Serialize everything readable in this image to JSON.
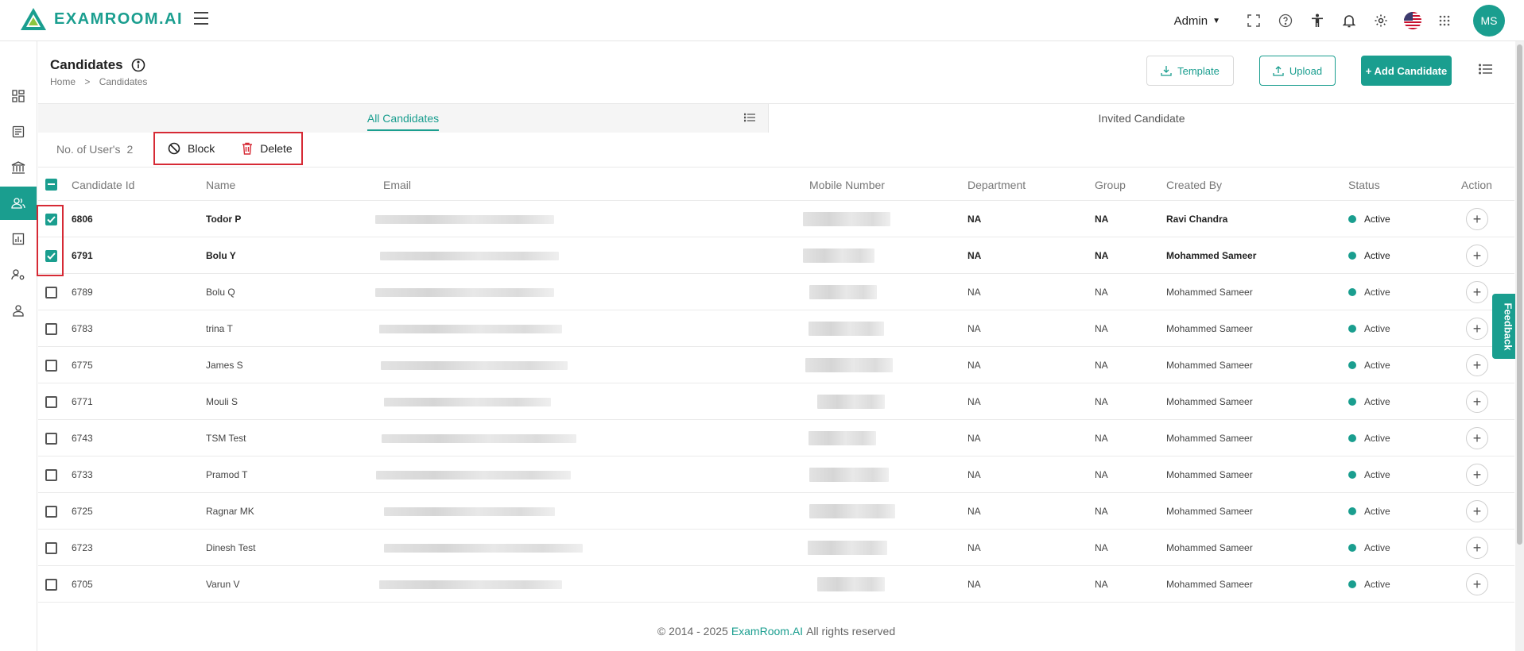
{
  "app": {
    "logo_text": "EXAMROOM.AI",
    "brand_color": "#1a9e8f",
    "highlight_color": "#d62a35"
  },
  "topbar": {
    "role": "Admin",
    "icons": [
      "fullscreen-icon",
      "help-icon",
      "accessibility-icon",
      "bell-icon",
      "settings-icon",
      "us-flag-icon",
      "apps-grid-icon"
    ],
    "avatar_initials": "MS"
  },
  "sidebar": {
    "items": [
      "dashboard-icon",
      "document-icon",
      "institution-icon",
      "candidates-icon",
      "reports-icon",
      "user-settings-icon",
      "profile-icon"
    ],
    "active_index": 3
  },
  "header": {
    "title": "Candidates",
    "breadcrumb": [
      "Home",
      "Candidates"
    ],
    "buttons": {
      "template": "Template",
      "upload": "Upload",
      "add": "+ Add Candidate"
    }
  },
  "tabs": {
    "all": "All Candidates",
    "invited": "Invited Candidate"
  },
  "toolbar": {
    "count_label": "No. of User's",
    "count_value": "2",
    "block_label": "Block",
    "delete_label": "Delete"
  },
  "table": {
    "columns": [
      "Candidate Id",
      "Name",
      "Email",
      "Mobile Number",
      "Department",
      "Group",
      "Created By",
      "Status",
      "Action"
    ],
    "rows": [
      {
        "id": "6806",
        "name": "Todor P",
        "department": "NA",
        "group": "NA",
        "created_by": "Ravi Chandra",
        "status": "Active",
        "selected": true
      },
      {
        "id": "6791",
        "name": "Bolu Y",
        "department": "NA",
        "group": "NA",
        "created_by": "Mohammed Sameer",
        "status": "Active",
        "selected": true
      },
      {
        "id": "6789",
        "name": "Bolu Q",
        "department": "NA",
        "group": "NA",
        "created_by": "Mohammed Sameer",
        "status": "Active",
        "selected": false
      },
      {
        "id": "6783",
        "name": "trina T",
        "department": "NA",
        "group": "NA",
        "created_by": "Mohammed Sameer",
        "status": "Active",
        "selected": false
      },
      {
        "id": "6775",
        "name": "James S",
        "department": "NA",
        "group": "NA",
        "created_by": "Mohammed Sameer",
        "status": "Active",
        "selected": false
      },
      {
        "id": "6771",
        "name": "Mouli S",
        "department": "NA",
        "group": "NA",
        "created_by": "Mohammed Sameer",
        "status": "Active",
        "selected": false
      },
      {
        "id": "6743",
        "name": "TSM Test",
        "department": "NA",
        "group": "NA",
        "created_by": "Mohammed Sameer",
        "status": "Active",
        "selected": false
      },
      {
        "id": "6733",
        "name": "Pramod T",
        "department": "NA",
        "group": "NA",
        "created_by": "Mohammed Sameer",
        "status": "Active",
        "selected": false
      },
      {
        "id": "6725",
        "name": "Ragnar MK",
        "department": "NA",
        "group": "NA",
        "created_by": "Mohammed Sameer",
        "status": "Active",
        "selected": false
      },
      {
        "id": "6723",
        "name": "Dinesh Test",
        "department": "NA",
        "group": "NA",
        "created_by": "Mohammed Sameer",
        "status": "Active",
        "selected": false
      },
      {
        "id": "6705",
        "name": "Varun V",
        "department": "NA",
        "group": "NA",
        "created_by": "Mohammed Sameer",
        "status": "Active",
        "selected": false
      }
    ]
  },
  "footer": {
    "prefix": "© 2014 - 2025",
    "brand": "ExamRoom.AI",
    "suffix": "All rights reserved"
  },
  "feedback": {
    "label": "Feedback"
  }
}
